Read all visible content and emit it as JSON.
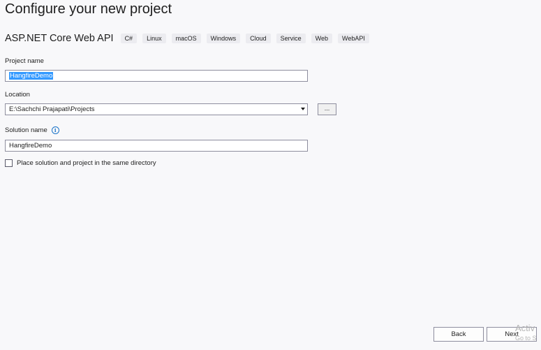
{
  "page": {
    "title": "Configure your new project"
  },
  "template": {
    "name": "ASP.NET Core Web API",
    "tags": [
      "C#",
      "Linux",
      "macOS",
      "Windows",
      "Cloud",
      "Service",
      "Web",
      "WebAPI"
    ]
  },
  "form": {
    "project_name_label": "Project name",
    "project_name_value": "HangfireDemo",
    "location_label": "Location",
    "location_value": "E:\\Sachchi Prajapati\\Projects",
    "browse_label": "...",
    "solution_name_label": "Solution name",
    "solution_name_value": "HangfireDemo",
    "same_directory_label": "Place solution and project in the same directory",
    "same_directory_checked": false
  },
  "footer": {
    "back_label": "Back",
    "next_label": "Next"
  },
  "watermark": {
    "line1": "Activ",
    "line2": "Go to S"
  }
}
